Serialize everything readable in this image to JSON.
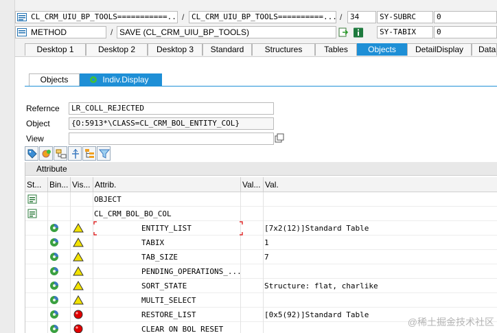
{
  "header": {
    "row1": {
      "field_a": "CL_CRM_UIU_BP_TOOLS===========...",
      "field_b": "CL_CRM_UIU_BP_TOOLS==========...",
      "line": "34",
      "sysvar": "SY-SUBRC",
      "sysval": "0",
      "sep": "/"
    },
    "row2": {
      "kind": "METHOD",
      "method": "SAVE (CL_CRM_UIU_BP_TOOLS)",
      "sysvar": "SY-TABIX",
      "sysval": "0",
      "sep": "/"
    }
  },
  "tabs": [
    "Desktop 1",
    "Desktop 2",
    "Desktop 3",
    "Standard",
    "Structures",
    "Tables",
    "Objects",
    "DetailDisplay",
    "Data"
  ],
  "subtabs": [
    "Objects",
    "Indiv.Display"
  ],
  "form": {
    "reference_label": "Refernce",
    "reference_value": "LR_COLL_REJECTED",
    "object_label": "Object",
    "object_value": "{O:5913*\\CLASS=CL_CRM_BOL_ENTITY_COL}",
    "view_label": "View",
    "view_value": ""
  },
  "grid": {
    "title": "Attribute",
    "columns": [
      "St...",
      "Bin...",
      "Vis...",
      "Attrib.",
      "Val...",
      "Val."
    ],
    "rows": [
      {
        "attr": "OBJECT",
        "value": ""
      },
      {
        "attr": "CL_CRM_BOL_BO_COL",
        "value": ""
      },
      {
        "attr": "ENTITY_LIST",
        "value": "[7x2(12)]Standard Table"
      },
      {
        "attr": "TABIX",
        "value": "1"
      },
      {
        "attr": "TAB_SIZE",
        "value": "7"
      },
      {
        "attr": "PENDING_OPERATIONS_...",
        "value": ""
      },
      {
        "attr": "SORT_STATE",
        "value": "Structure: flat, charlike"
      },
      {
        "attr": "MULTI_SELECT",
        "value": ""
      },
      {
        "attr": "RESTORE_LIST",
        "value": "[0x5(92)]Standard Table"
      },
      {
        "attr": "CLEAR_ON_BOL_RESET",
        "value": ""
      }
    ]
  },
  "watermark": "@稀土掘金技术社区",
  "colors": {
    "accent": "#1e8fd6",
    "warning": "#f2e200",
    "error": "#e00000",
    "status_green": "#3aa040"
  }
}
